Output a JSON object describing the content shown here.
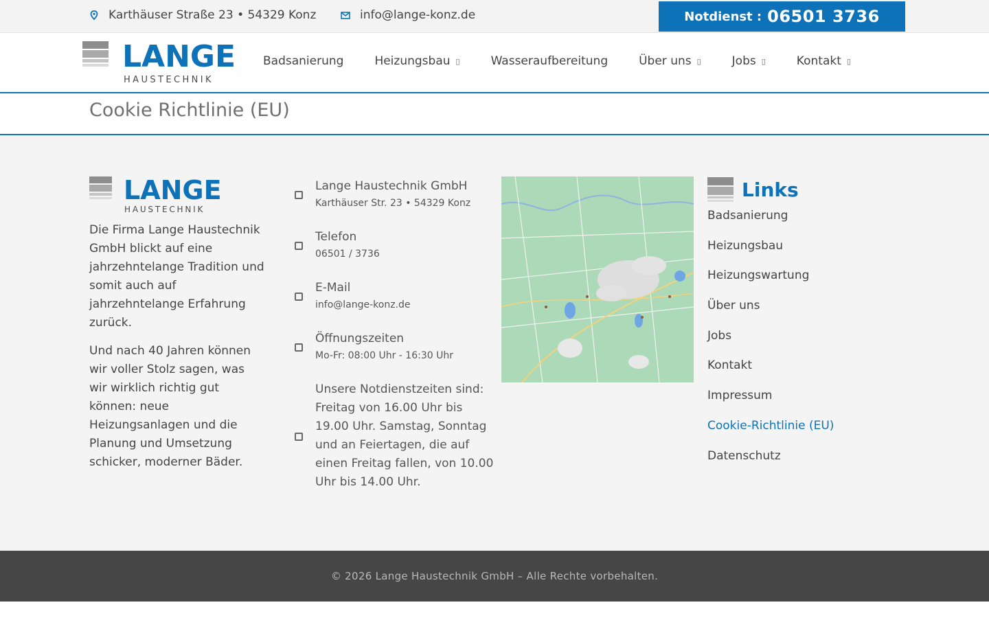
{
  "topbar": {
    "address": "Karthäuser Straße 23 • 54329 Konz",
    "email": "info@lange-konz.de",
    "emergency_label": "Notdienst :",
    "emergency_number": "06501 3736"
  },
  "brand": {
    "name": "LANGE",
    "tagline": "HAUSTECHNIK",
    "color": "#0d72b8"
  },
  "nav": [
    {
      "label": "Badsanierung",
      "dropdown": false
    },
    {
      "label": "Heizungsbau",
      "dropdown": true
    },
    {
      "label": "Wasseraufbereitung",
      "dropdown": false
    },
    {
      "label": "Über uns",
      "dropdown": true
    },
    {
      "label": "Jobs",
      "dropdown": true
    },
    {
      "label": "Kontakt",
      "dropdown": true
    }
  ],
  "page": {
    "title": "Cookie Richtlinie (EU)"
  },
  "about": {
    "p1": "Die Firma Lange Haustechnik GmbH blickt auf eine jahrzehntelange Tradition und somit auch auf jahrzehntelange Erfahrung zurück.",
    "p2": "Und nach 40 Jahren können wir voller Stolz sagen, was wir wirklich richtig gut können: neue Heizungsanlagen und die Planung und Umsetzung schicker, moderner Bäder."
  },
  "contact": [
    {
      "icon": "home-icon",
      "title": "Lange Haustechnik GmbH",
      "sub": "Karthäuser Str. 23 • 54329 Konz"
    },
    {
      "icon": "phone-icon",
      "title": "Telefon",
      "sub": "06501 / 3736"
    },
    {
      "icon": "mail-icon",
      "title": "E-Mail",
      "sub": "info@lange-konz.de"
    },
    {
      "icon": "clock-icon",
      "title": "Öffnungszeiten",
      "sub": "Mo-Fr: 08:00 Uhr - 16:30 Uhr"
    },
    {
      "icon": "info-icon",
      "text": "Unsere Notdienstzeiten sind: Freitag von 16.00 Uhr bis 19.00 Uhr. Samstag, Sonntag und an Feiertagen, die auf einen Freitag fallen, von 10.00 Uhr bis 14.00 Uhr."
    }
  ],
  "links": {
    "title": "Links",
    "items": [
      {
        "label": "Badsanierung"
      },
      {
        "label": "Heizungsbau"
      },
      {
        "label": "Heizungswartung"
      },
      {
        "label": "Über uns"
      },
      {
        "label": "Jobs"
      },
      {
        "label": "Kontakt"
      },
      {
        "label": "Impressum"
      },
      {
        "label": "Cookie-Richtlinie (EU)",
        "active": true
      },
      {
        "label": "Datenschutz"
      }
    ]
  },
  "copyright": "© 2026 Lange Haustechnik GmbH – Alle Rechte vorbehalten."
}
